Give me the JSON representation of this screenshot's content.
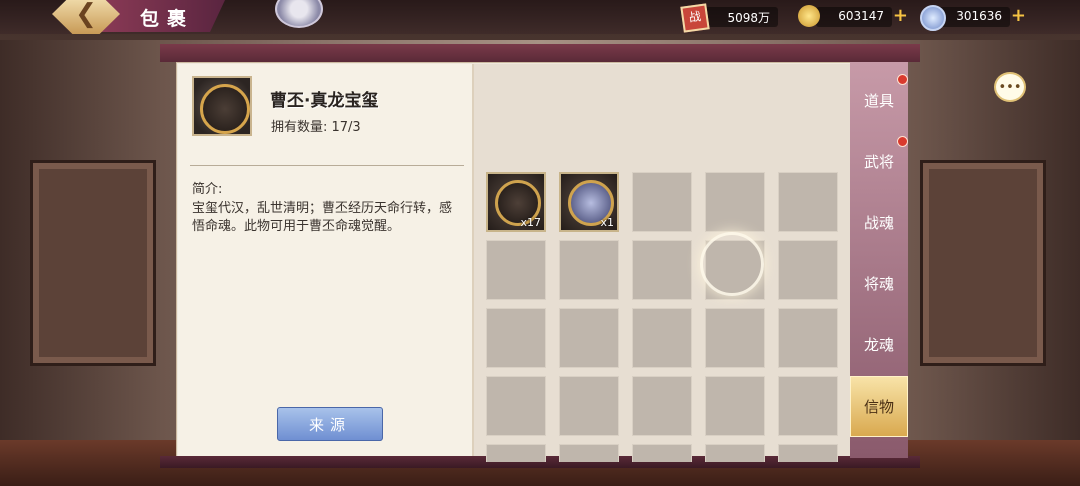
{
  "header": {
    "title": "包裹",
    "back_icon": "arrow-left-icon"
  },
  "resources": [
    {
      "icon": "zhan-token-icon",
      "glyph": "战",
      "value": "5098万",
      "has_plus": false
    },
    {
      "icon": "gold-ingot-icon",
      "value": "603147",
      "has_plus": true
    },
    {
      "icon": "jade-coin-icon",
      "value": "301636",
      "has_plus": true
    }
  ],
  "item": {
    "name": "曹丕·真龙宝玺",
    "count_label": "拥有数量: 17/3",
    "desc_title": "简介:",
    "desc_text": "宝玺代汉，乱世清明；曹丕经历天命行转，感悟命魂。此物可用于曹丕命魂觉醒。",
    "source_button": "来源"
  },
  "grid": {
    "items": [
      {
        "qty": "x17",
        "variant": "dark"
      },
      {
        "qty": "x1",
        "variant": "light"
      }
    ]
  },
  "tabs": [
    {
      "label": "道具",
      "badge": true,
      "active": false
    },
    {
      "label": "武将",
      "badge": true,
      "active": false
    },
    {
      "label": "战魂",
      "badge": false,
      "active": false
    },
    {
      "label": "将魂",
      "badge": false,
      "active": false
    },
    {
      "label": "龙魂",
      "badge": false,
      "active": false
    },
    {
      "label": "信物",
      "badge": false,
      "active": true
    }
  ],
  "colors": {
    "accent_tab": "#d9a94f",
    "source_button": "#6f8fd2",
    "badge": "#d93a2e"
  }
}
